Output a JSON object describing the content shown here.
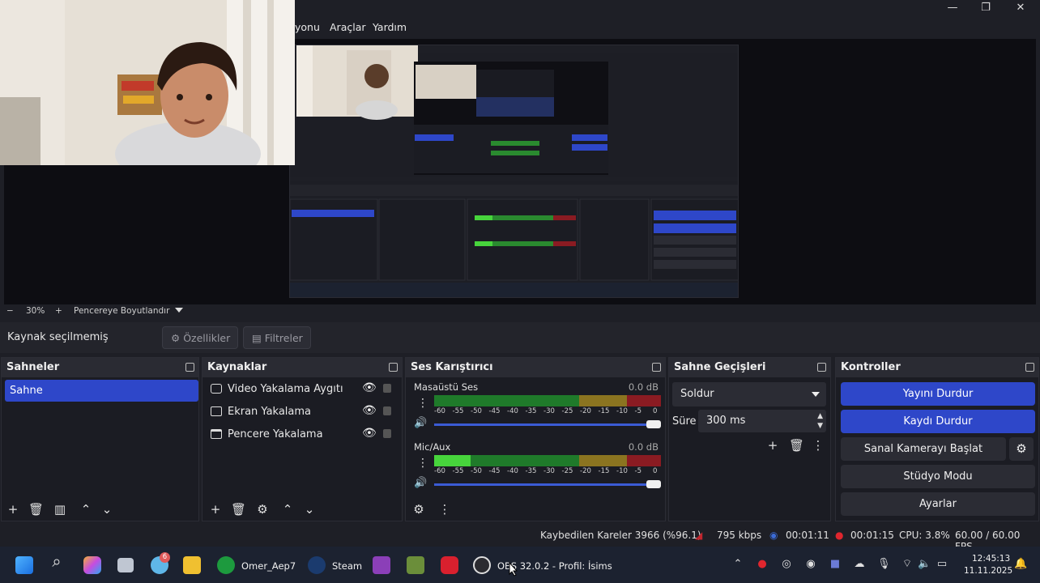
{
  "menu": {
    "items": [
      "yonu",
      "Araçlar",
      "Yardım"
    ]
  },
  "window_controls": {
    "minimize": "—",
    "maximize": "❐",
    "close": "✕"
  },
  "nested_preview": {
    "menu": [
      "Araçlar",
      "Yardım"
    ],
    "source_label": "Kaynak seçilmemiş",
    "scene": "Sahne",
    "sources": [
      "Video Yakalama Aygıtı",
      "Ekran Yakalama",
      "Pencere Yakalama"
    ],
    "status": "Kaybedilen Kareler 3966 (%96.1)"
  },
  "zoom": {
    "minus": "−",
    "percent": "30%",
    "plus": "+",
    "fit_label": "Pencereye Boyutlandır"
  },
  "source_toolbar": {
    "no_source": "Kaynak seçilmemiş",
    "properties": "Özellikler",
    "filters": "Filtreler"
  },
  "scenes": {
    "title": "Sahneler",
    "items": [
      "Sahne"
    ]
  },
  "sources": {
    "title": "Kaynaklar",
    "items": [
      {
        "label": "Video Yakalama Aygıtı",
        "icon": "camera-icon"
      },
      {
        "label": "Ekran Yakalama",
        "icon": "monitor-icon"
      },
      {
        "label": "Pencere Yakalama",
        "icon": "window-icon"
      }
    ]
  },
  "mixer": {
    "title": "Ses Karıştırıcı",
    "channels": [
      {
        "name": "Masaüstü Ses",
        "db": "0.0 dB",
        "level": 0.0
      },
      {
        "name": "Mic/Aux",
        "db": "0.0 dB",
        "level": 0.16
      }
    ],
    "ticks": [
      "-60",
      "-55",
      "-50",
      "-45",
      "-40",
      "-35",
      "-30",
      "-25",
      "-20",
      "-15",
      "-10",
      "-5",
      "0"
    ]
  },
  "transitions": {
    "title": "Sahne Geçişleri",
    "selected": "Soldur",
    "duration_label": "Süre",
    "duration_value": "300 ms"
  },
  "controls": {
    "title": "Kontroller",
    "stop_stream": "Yayını Durdur",
    "stop_record": "Kaydı Durdur",
    "virtual_cam": "Sanal Kamerayı Başlat",
    "studio_mode": "Stüdyo Modu",
    "settings": "Ayarlar"
  },
  "status": {
    "dropped": "Kaybedilen Kareler 3966 (%96.1)",
    "bitrate": "795 kbps",
    "stream_time": "00:01:11",
    "rec_time": "00:01:15",
    "cpu": "CPU: 3.8%",
    "fps": "60.00 / 60.00 FPS"
  },
  "taskbar": {
    "app1": "Omer_Aep7",
    "app2": "Steam",
    "obs": "OBS 32.0.2 - Profil: İsims",
    "badge": "6",
    "time": "12:45:13",
    "date": "11.11.2025"
  },
  "colors": {
    "accent": "#2e47c9",
    "background": "#1e1f26",
    "dock": "#1b1c23"
  }
}
